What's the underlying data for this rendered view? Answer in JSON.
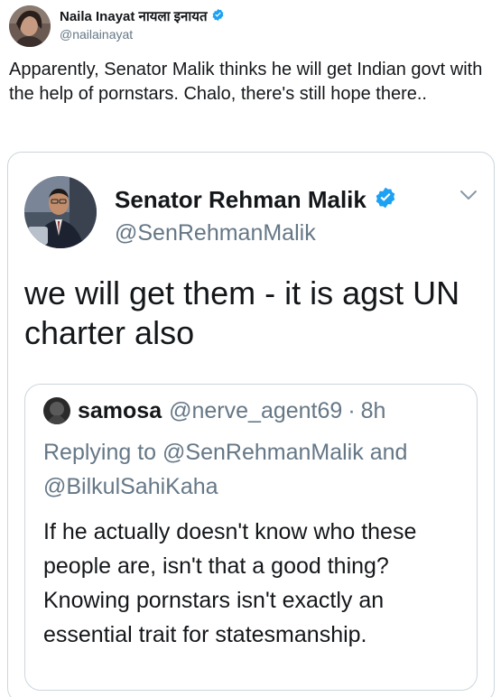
{
  "tweet": {
    "author_name": "Naila Inayat नायला इनायत",
    "author_handle": "@nailainayat",
    "text": "Apparently, Senator Malik thinks he will get Indian govt with the help of pornstars. Chalo, there's still hope there.."
  },
  "quoted_tweet": {
    "author_name": "Senator Rehman Malik",
    "author_handle": "@SenRehmanMalik",
    "text": "we will get them - it is agst UN charter also"
  },
  "inner_quoted_tweet": {
    "author_name": "samosa",
    "author_handle": "@nerve_agent69",
    "separator": "·",
    "time": "8h",
    "replying_to_label": "Replying to",
    "replying_to_user1": "@SenRehmanMalik",
    "replying_and": "and",
    "replying_to_user2": "@BilkulSahiKaha",
    "text_line1": "If he actually doesn't know who these people are, isn't that a good thing?",
    "text_line2": "Knowing pornstars isn't exactly an essential trait for statesmanship."
  },
  "colors": {
    "verified": "#1da1f2",
    "secondary_text": "#657786",
    "border": "#ccd6dd"
  },
  "icons": {
    "verified": "verified-badge-icon",
    "chevron": "chevron-down-icon"
  }
}
